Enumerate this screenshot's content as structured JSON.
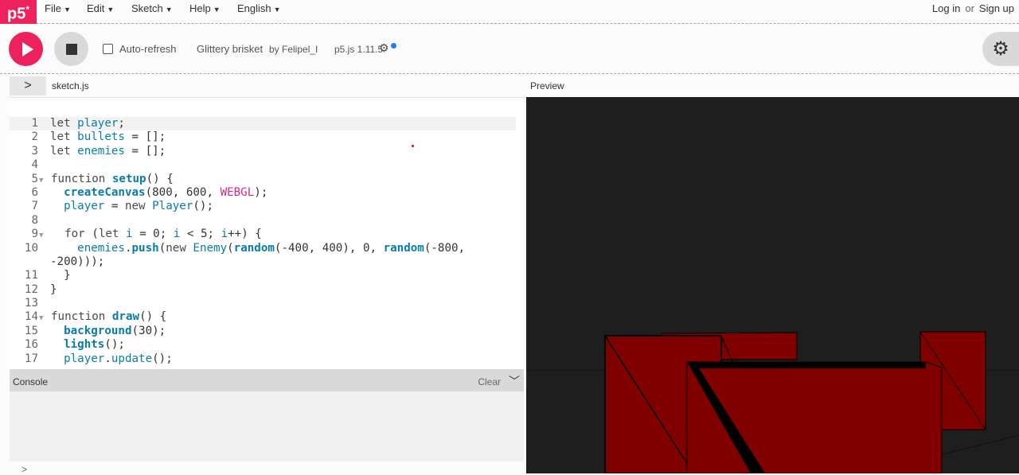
{
  "nav": {
    "logo": "p5",
    "logo_star": "*",
    "menus": [
      "File",
      "Edit",
      "Sketch",
      "Help",
      "English"
    ],
    "login": "Log in",
    "or": "or",
    "signup": "Sign up"
  },
  "toolbar": {
    "autorefresh_label": "Auto-refresh",
    "sketch_name": "Glittery brisket",
    "author": "by Felipel_I",
    "version": "p5.js 1.11.5"
  },
  "editor": {
    "filename": "sketch.js",
    "preview_label": "Preview"
  },
  "code_lines": [
    "1",
    "2",
    "3",
    "4",
    "5",
    "6",
    "7",
    "8",
    "9",
    "10",
    "",
    "11",
    "12",
    "13",
    "14",
    "15",
    "16",
    "17"
  ],
  "console": {
    "title": "Console",
    "clear": "Clear",
    "prompt": ">"
  },
  "colors": {
    "accent": "#ed225d",
    "preview_bg": "#1e1e1e",
    "cube_fill": "#800000"
  },
  "icons": [
    "play-icon",
    "stop-icon",
    "gear-icon",
    "chevron-right-icon",
    "chevron-down-icon"
  ]
}
